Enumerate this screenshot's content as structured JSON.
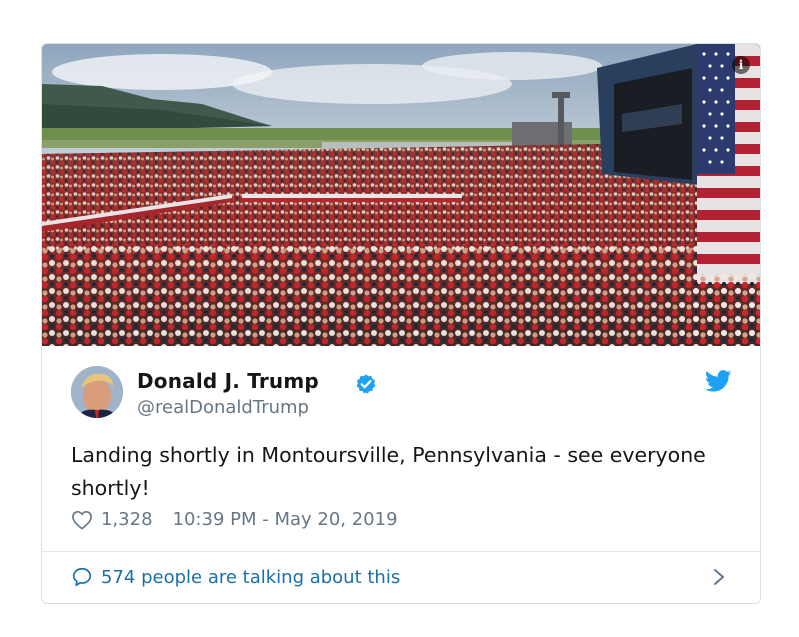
{
  "tweet": {
    "author_name": "Donald J. Trump",
    "handle": "@realDonaldTrump",
    "text": "Landing shortly in Montoursville, Pennsylvania - see everyone shortly!",
    "likes": "1,328",
    "timestamp": "10:39 PM - May 20, 2019",
    "talking_text": "574 people are talking about this",
    "verified": true
  },
  "photo": {
    "info_label": "i"
  },
  "icons": {
    "verified": "verified-badge-icon",
    "bird": "twitter-bird-icon",
    "heart": "heart-icon",
    "bubble": "speech-bubble-icon",
    "chevron": "chevron-right-icon",
    "info": "info-icon"
  },
  "colors": {
    "twitter_blue": "#1da1f2",
    "link_blue": "#1b6fa8",
    "text": "#14171a",
    "muted": "#657786",
    "border": "#d9e1e8"
  }
}
